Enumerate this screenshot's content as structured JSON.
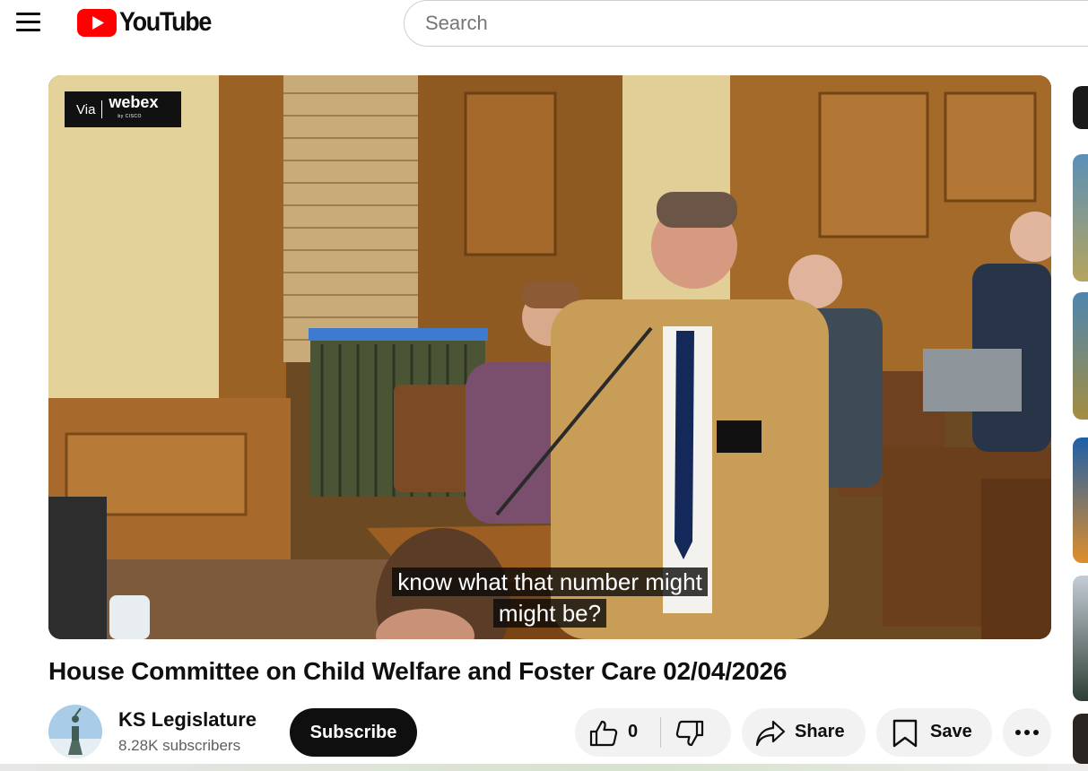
{
  "header": {
    "logo_text": "YouTube",
    "search_placeholder": "Search"
  },
  "player": {
    "watermark_via": "Via",
    "watermark_brand": "webex",
    "watermark_sub": "by CISCO",
    "caption_line1": "know what that number might",
    "caption_line2": "might be?"
  },
  "video": {
    "title": "House Committee on Child Welfare and Foster Care 02/04/2026"
  },
  "channel": {
    "name": "KS Legislature",
    "subscribers": "8.28K subscribers",
    "subscribe_label": "Subscribe"
  },
  "actions": {
    "like_count": "0",
    "share_label": "Share",
    "save_label": "Save"
  },
  "colors": {
    "brand_red": "#ff0000",
    "text": "#0f0f0f",
    "secondary_text": "#606060",
    "pill_bg": "#f2f2f2"
  },
  "icons": [
    "menu-icon",
    "youtube-logo-icon",
    "like-icon",
    "dislike-icon",
    "share-icon",
    "save-icon",
    "more-icon"
  ]
}
